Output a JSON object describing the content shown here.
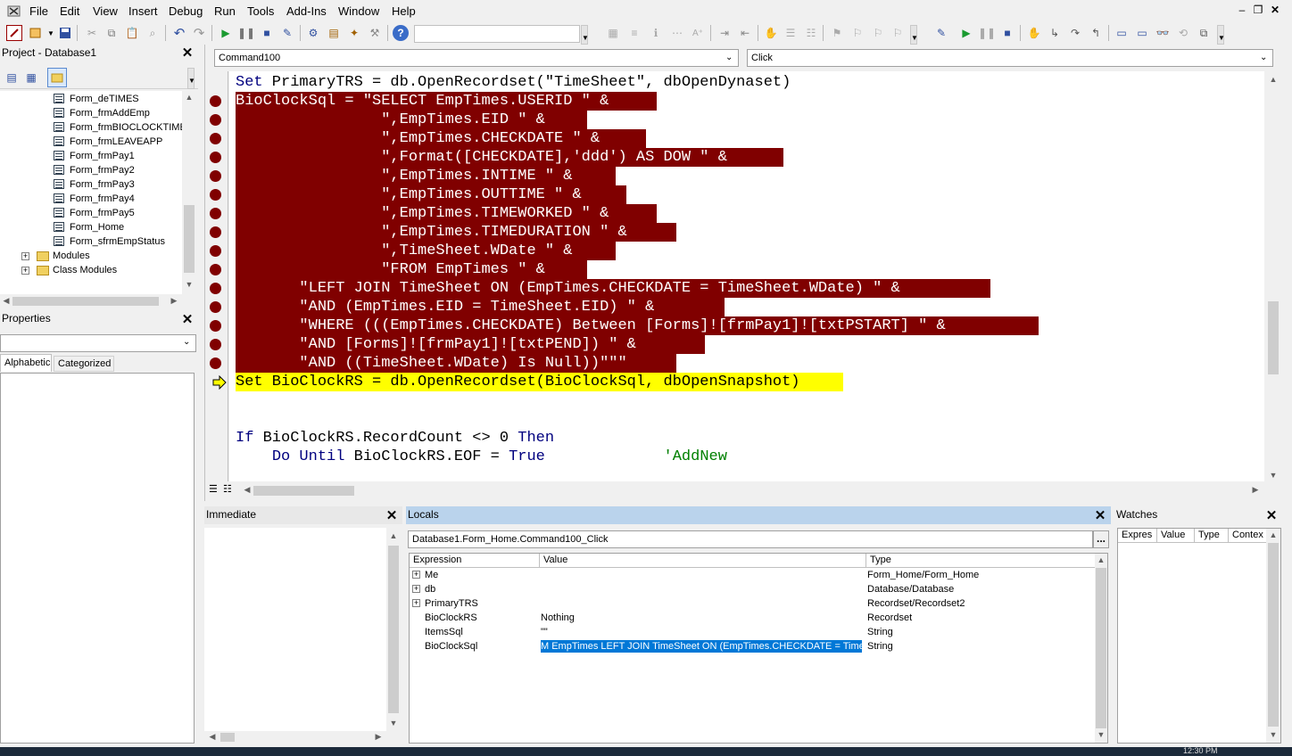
{
  "menu": [
    "File",
    "Edit",
    "View",
    "Insert",
    "Debug",
    "Run",
    "Tools",
    "Add-Ins",
    "Window",
    "Help"
  ],
  "project": {
    "title": "Project - Database1",
    "items": [
      "Form_deTIMES",
      "Form_frmAddEmp",
      "Form_frmBIOCLOCKTIMES",
      "Form_frmLEAVEAPP",
      "Form_frmPay1",
      "Form_frmPay2",
      "Form_frmPay3",
      "Form_frmPay4",
      "Form_frmPay5",
      "Form_Home",
      "Form_sfrmEmpStatus"
    ],
    "folders": [
      "Modules",
      "Class Modules"
    ]
  },
  "properties": {
    "title": "Properties",
    "tab_alpha": "Alphabetic",
    "tab_cat": "Categorized"
  },
  "code": {
    "object_combo": "Command100",
    "proc_combo": "Click",
    "lines": [
      "Set PrimaryTRS = db.OpenRecordset(\"TimeSheet\", dbOpenDynaset)",
      "BioClockSql = \"SELECT EmpTimes.USERID \" & ",
      "                \",EmpTimes.EID \" & ",
      "                \",EmpTimes.CHECKDATE \" & ",
      "                \",Format([CHECKDATE],'ddd') AS DOW \" & ",
      "                \",EmpTimes.INTIME \" & ",
      "                \",EmpTimes.OUTTIME \" & ",
      "                \",EmpTimes.TIMEWORKED \" & ",
      "                \",EmpTimes.TIMEDURATION \" & ",
      "                \",TimeSheet.WDate \" & ",
      "                \"FROM EmpTimes \" & ",
      "       \"LEFT JOIN TimeSheet ON (EmpTimes.CHECKDATE = TimeSheet.WDate) \" & ",
      "       \"AND (EmpTimes.EID = TimeSheet.EID) \" & ",
      "       \"WHERE (((EmpTimes.CHECKDATE) Between [Forms]![frmPay1]![txtPSTART] \" & ",
      "       \"AND [Forms]![frmPay1]![txtPEND]) \" & ",
      "       \"AND ((TimeSheet.WDate) Is Null))\"\"\"",
      "Set BioClockRS = db.OpenRecordset(BioClockSql, dbOpenSnapshot)",
      "",
      "",
      "If BioClockRS.RecordCount <> 0 Then",
      "    Do Until BioClockRS.EOF = True             'AddNew"
    ]
  },
  "immediate": {
    "title": "Immediate"
  },
  "locals": {
    "title": "Locals",
    "context": "Database1.Form_Home.Command100_Click",
    "context_btn": "...",
    "headers": [
      "Expression",
      "Value",
      "Type"
    ],
    "rows": [
      {
        "expr": "Me",
        "value": "",
        "type": "Form_Home/Form_Home",
        "expandable": true
      },
      {
        "expr": "db",
        "value": "",
        "type": "Database/Database",
        "expandable": true
      },
      {
        "expr": "PrimaryTRS",
        "value": "",
        "type": "Recordset/Recordset2",
        "expandable": true
      },
      {
        "expr": "BioClockRS",
        "value": "Nothing",
        "type": "Recordset",
        "expandable": false
      },
      {
        "expr": "ItemsSql",
        "value": "\"\"",
        "type": "String",
        "expandable": false
      },
      {
        "expr": "BioClockSql",
        "value": "M EmpTimes LEFT JOIN TimeSheet ON (EmpTimes.CHECKDATE = TimeShe",
        "type": "String",
        "expandable": false
      }
    ]
  },
  "watches": {
    "title": "Watches",
    "headers": [
      "Expres",
      "Value",
      "Type",
      "Contex"
    ]
  },
  "taskbar": {
    "clock": "12:30 PM"
  },
  "colors": {
    "breakpoint": "#800000",
    "current": "#ffff00",
    "selection": "#0078d7"
  }
}
